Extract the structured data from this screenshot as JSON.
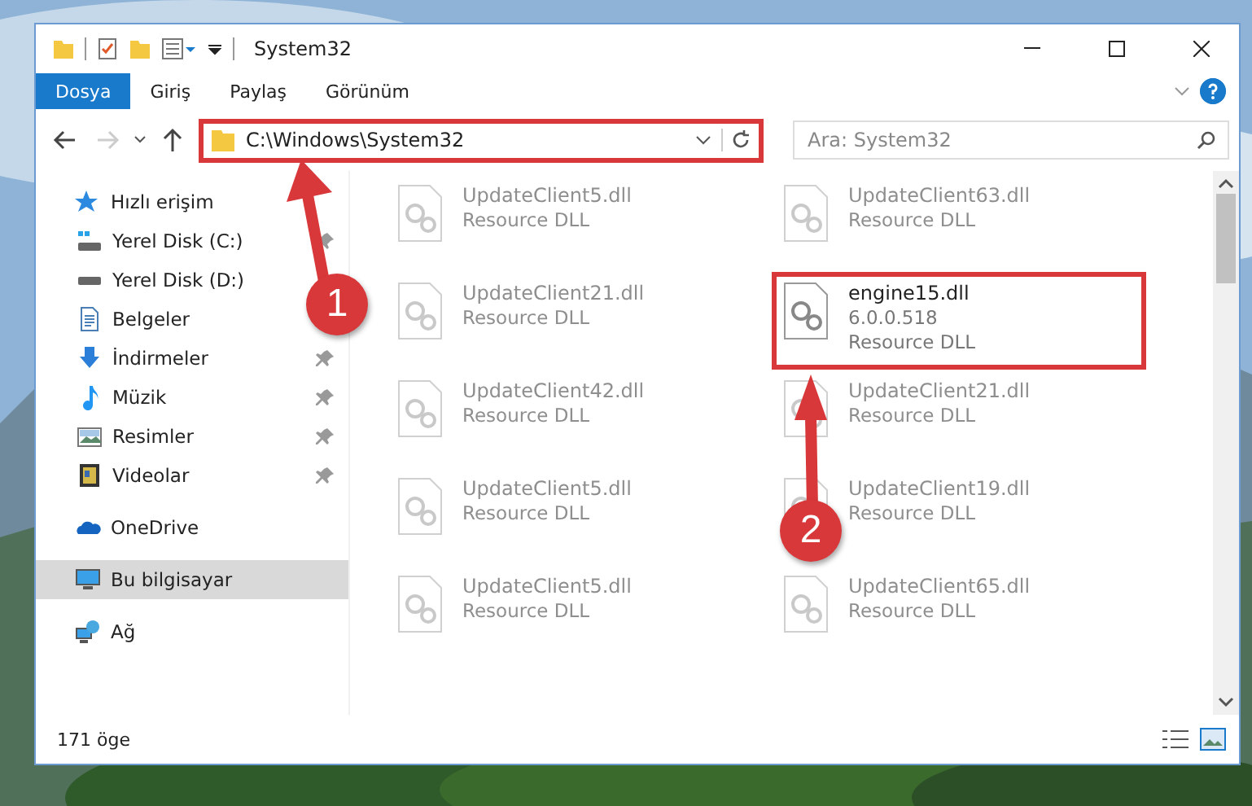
{
  "window": {
    "title": "System32"
  },
  "ribbon_tabs": [
    {
      "label": "Dosya",
      "selected": true
    },
    {
      "label": "Giriş",
      "selected": false
    },
    {
      "label": "Paylaş",
      "selected": false
    },
    {
      "label": "Görünüm",
      "selected": false
    }
  ],
  "address_bar": {
    "path": "C:\\Windows\\System32",
    "highlighted": true
  },
  "search": {
    "placeholder": "Ara: System32"
  },
  "sidebar": {
    "items": [
      {
        "label": "Hızlı erişim",
        "selected": false,
        "children": [
          {
            "label": "Yerel Disk (C:)",
            "pinned": true
          },
          {
            "label": "Yerel Disk (D:)",
            "pinned": false
          },
          {
            "label": "Belgeler",
            "pinned": false
          },
          {
            "label": "İndirmeler",
            "pinned": true
          },
          {
            "label": "Müzik",
            "pinned": true
          },
          {
            "label": "Resimler",
            "pinned": true
          },
          {
            "label": "Videolar",
            "pinned": true
          }
        ]
      },
      {
        "label": "OneDrive",
        "selected": false
      },
      {
        "label": "Bu bilgisayar",
        "selected": true
      },
      {
        "label": "Ağ",
        "selected": false
      }
    ]
  },
  "files": [
    {
      "name": "UpdateClient5.dll",
      "details": [
        "Resource DLL"
      ],
      "faded": true,
      "highlighted": false
    },
    {
      "name": "UpdateClient63.dll",
      "details": [
        "Resource DLL"
      ],
      "faded": true,
      "highlighted": false
    },
    {
      "name": "UpdateClient21.dll",
      "details": [
        "Resource DLL"
      ],
      "faded": true,
      "highlighted": false
    },
    {
      "name": "engine15.dll",
      "details": [
        "6.0.0.518",
        "Resource DLL"
      ],
      "faded": false,
      "highlighted": true
    },
    {
      "name": "UpdateClient42.dll",
      "details": [
        "Resource DLL"
      ],
      "faded": true,
      "highlighted": false
    },
    {
      "name": "UpdateClient21.dll",
      "details": [
        "Resource DLL"
      ],
      "faded": true,
      "highlighted": false
    },
    {
      "name": "UpdateClient5.dll",
      "details": [
        "Resource DLL"
      ],
      "faded": true,
      "highlighted": false
    },
    {
      "name": "UpdateClient19.dll",
      "details": [
        "Resource DLL"
      ],
      "faded": true,
      "highlighted": false
    },
    {
      "name": "UpdateClient5.dll",
      "details": [
        "Resource DLL"
      ],
      "faded": true,
      "highlighted": false
    },
    {
      "name": "UpdateClient65.dll",
      "details": [
        "Resource DLL"
      ],
      "faded": true,
      "highlighted": false
    }
  ],
  "status_bar": {
    "item_count": "171 öge"
  },
  "annotations": [
    {
      "label": "1"
    },
    {
      "label": "2"
    }
  ]
}
